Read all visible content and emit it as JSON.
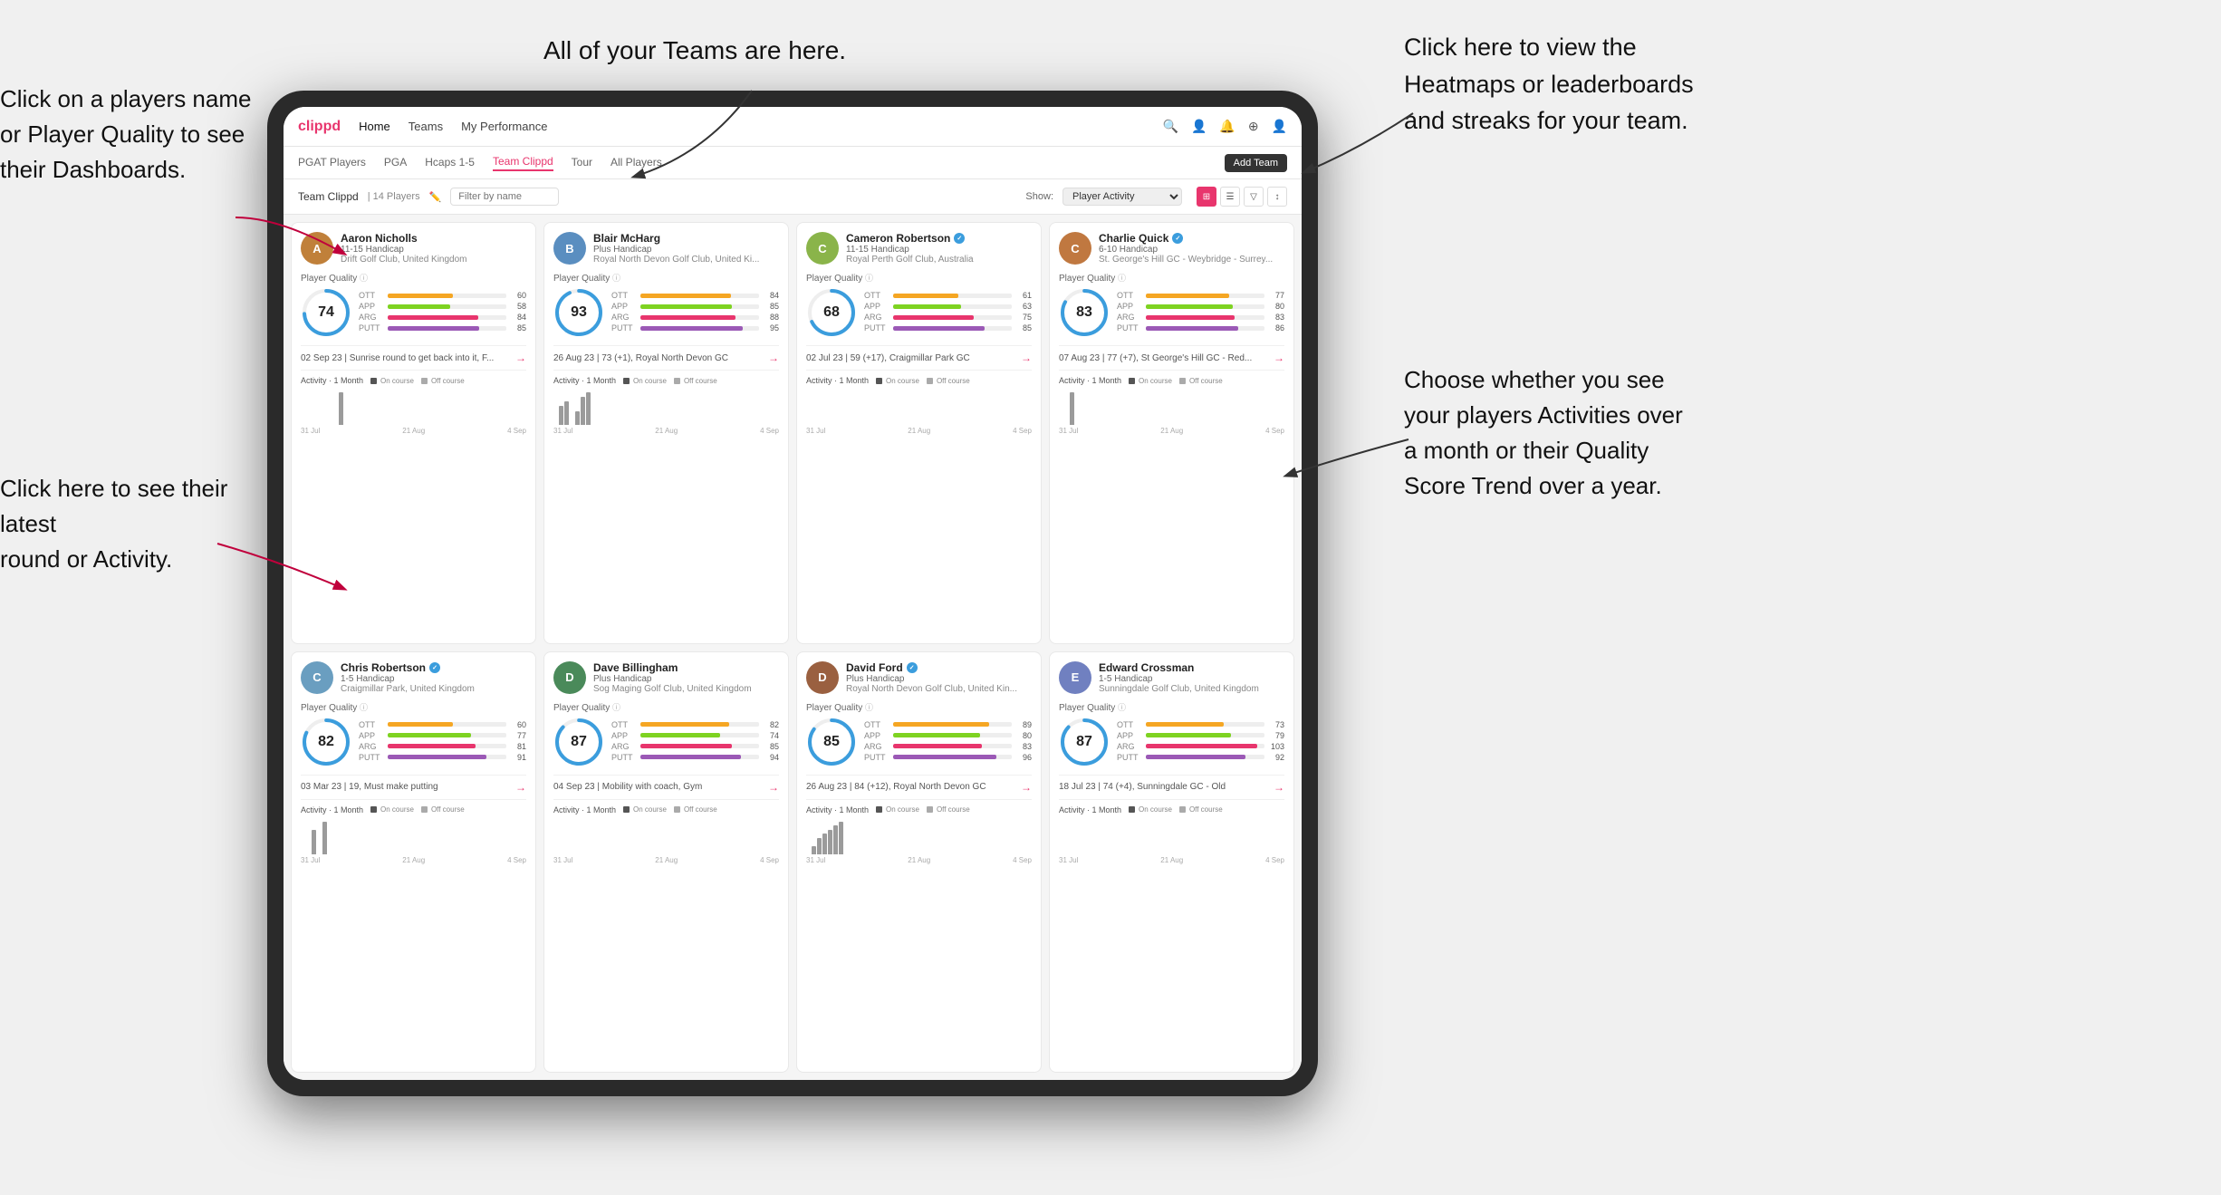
{
  "annotations": {
    "teams_tooltip": "All of your Teams are here.",
    "heatmaps_tooltip": "Click here to view the\nHeatmaps or leaderboards\nand streaks for your team.",
    "player_name_tooltip": "Click on a players name\nor Player Quality to see\ntheir Dashboards.",
    "latest_round_tooltip": "Click here to see their latest\nround or Activity.",
    "activity_tooltip": "Choose whether you see\nyour players Activities over\na month or their Quality\nScore Trend over a year."
  },
  "nav": {
    "logo": "clippd",
    "items": [
      "Home",
      "Teams",
      "My Performance"
    ],
    "icons": [
      "🔍",
      "👤",
      "🔔",
      "⊕",
      "👤"
    ]
  },
  "sub_nav": {
    "tabs": [
      "PGAT Players",
      "PGA",
      "Hcaps 1-5",
      "Team Clippd",
      "Tour",
      "All Players"
    ],
    "active": "Team Clippd",
    "add_team_label": "Add Team"
  },
  "team_bar": {
    "title": "Team Clippd",
    "separator": "|",
    "count": "14 Players",
    "filter_placeholder": "Filter by name",
    "show_label": "Show:",
    "show_options": [
      "Player Activity"
    ],
    "show_selected": "Player Activity"
  },
  "players": [
    {
      "name": "Aaron Nicholls",
      "handicap": "11-15 Handicap",
      "club": "Drift Golf Club, United Kingdom",
      "verified": false,
      "quality": 74,
      "quality_color": "#3b9ddd",
      "stats": [
        {
          "label": "OTT",
          "value": 60,
          "color": "#f5a623"
        },
        {
          "label": "APP",
          "value": 58,
          "color": "#7ed321"
        },
        {
          "label": "ARG",
          "value": 84,
          "color": "#e8356d"
        },
        {
          "label": "PUTT",
          "value": 85,
          "color": "#9b59b6"
        }
      ],
      "latest_round": "02 Sep 23 | Sunrise round to get back into it, F...",
      "activity_bars": [
        0,
        0,
        0,
        0,
        0,
        0,
        0,
        3,
        0,
        0
      ],
      "dates": [
        "31 Jul",
        "21 Aug",
        "4 Sep"
      ]
    },
    {
      "name": "Blair McHarg",
      "handicap": "Plus Handicap",
      "club": "Royal North Devon Golf Club, United Ki...",
      "verified": false,
      "quality": 93,
      "quality_color": "#3b9ddd",
      "stats": [
        {
          "label": "OTT",
          "value": 84,
          "color": "#f5a623"
        },
        {
          "label": "APP",
          "value": 85,
          "color": "#7ed321"
        },
        {
          "label": "ARG",
          "value": 88,
          "color": "#e8356d"
        },
        {
          "label": "PUTT",
          "value": 95,
          "color": "#9b59b6"
        }
      ],
      "latest_round": "26 Aug 23 | 73 (+1), Royal North Devon GC",
      "activity_bars": [
        0,
        4,
        5,
        0,
        3,
        6,
        7,
        0,
        0,
        0
      ],
      "dates": [
        "31 Jul",
        "21 Aug",
        "4 Sep"
      ]
    },
    {
      "name": "Cameron Robertson",
      "handicap": "11-15 Handicap",
      "club": "Royal Perth Golf Club, Australia",
      "verified": true,
      "quality": 68,
      "quality_color": "#3b9ddd",
      "stats": [
        {
          "label": "OTT",
          "value": 61,
          "color": "#f5a623"
        },
        {
          "label": "APP",
          "value": 63,
          "color": "#7ed321"
        },
        {
          "label": "ARG",
          "value": 75,
          "color": "#e8356d"
        },
        {
          "label": "PUTT",
          "value": 85,
          "color": "#9b59b6"
        }
      ],
      "latest_round": "02 Jul 23 | 59 (+17), Craigmillar Park GC",
      "activity_bars": [
        0,
        0,
        0,
        0,
        0,
        0,
        0,
        0,
        0,
        0
      ],
      "dates": [
        "31 Jul",
        "21 Aug",
        "4 Sep"
      ]
    },
    {
      "name": "Charlie Quick",
      "handicap": "6-10 Handicap",
      "club": "St. George's Hill GC - Weybridge - Surrey...",
      "verified": true,
      "quality": 83,
      "quality_color": "#3b9ddd",
      "stats": [
        {
          "label": "OTT",
          "value": 77,
          "color": "#f5a623"
        },
        {
          "label": "APP",
          "value": 80,
          "color": "#7ed321"
        },
        {
          "label": "ARG",
          "value": 83,
          "color": "#e8356d"
        },
        {
          "label": "PUTT",
          "value": 86,
          "color": "#9b59b6"
        }
      ],
      "latest_round": "07 Aug 23 | 77 (+7), St George's Hill GC - Red...",
      "activity_bars": [
        0,
        0,
        3,
        0,
        0,
        0,
        0,
        0,
        0,
        0
      ],
      "dates": [
        "31 Jul",
        "21 Aug",
        "4 Sep"
      ]
    },
    {
      "name": "Chris Robertson",
      "handicap": "1-5 Handicap",
      "club": "Craigmillar Park, United Kingdom",
      "verified": true,
      "quality": 82,
      "quality_color": "#3b9ddd",
      "stats": [
        {
          "label": "OTT",
          "value": 60,
          "color": "#f5a623"
        },
        {
          "label": "APP",
          "value": 77,
          "color": "#7ed321"
        },
        {
          "label": "ARG",
          "value": 81,
          "color": "#e8356d"
        },
        {
          "label": "PUTT",
          "value": 91,
          "color": "#9b59b6"
        }
      ],
      "latest_round": "03 Mar 23 | 19, Must make putting",
      "activity_bars": [
        0,
        0,
        3,
        0,
        4,
        0,
        0,
        0,
        0,
        0
      ],
      "dates": [
        "31 Jul",
        "21 Aug",
        "4 Sep"
      ]
    },
    {
      "name": "Dave Billingham",
      "handicap": "Plus Handicap",
      "club": "Sog Maging Golf Club, United Kingdom",
      "verified": false,
      "quality": 87,
      "quality_color": "#3b9ddd",
      "stats": [
        {
          "label": "OTT",
          "value": 82,
          "color": "#f5a623"
        },
        {
          "label": "APP",
          "value": 74,
          "color": "#7ed321"
        },
        {
          "label": "ARG",
          "value": 85,
          "color": "#e8356d"
        },
        {
          "label": "PUTT",
          "value": 94,
          "color": "#9b59b6"
        }
      ],
      "latest_round": "04 Sep 23 | Mobility with coach, Gym",
      "activity_bars": [
        0,
        0,
        0,
        0,
        0,
        0,
        0,
        0,
        0,
        0
      ],
      "dates": [
        "31 Jul",
        "21 Aug",
        "4 Sep"
      ]
    },
    {
      "name": "David Ford",
      "handicap": "Plus Handicap",
      "club": "Royal North Devon Golf Club, United Kin...",
      "verified": true,
      "quality": 85,
      "quality_color": "#3b9ddd",
      "stats": [
        {
          "label": "OTT",
          "value": 89,
          "color": "#f5a623"
        },
        {
          "label": "APP",
          "value": 80,
          "color": "#7ed321"
        },
        {
          "label": "ARG",
          "value": 83,
          "color": "#e8356d"
        },
        {
          "label": "PUTT",
          "value": 96,
          "color": "#9b59b6"
        }
      ],
      "latest_round": "26 Aug 23 | 84 (+12), Royal North Devon GC",
      "activity_bars": [
        0,
        2,
        4,
        5,
        6,
        7,
        8,
        0,
        0,
        0
      ],
      "dates": [
        "31 Jul",
        "21 Aug",
        "4 Sep"
      ]
    },
    {
      "name": "Edward Crossman",
      "handicap": "1-5 Handicap",
      "club": "Sunningdale Golf Club, United Kingdom",
      "verified": false,
      "quality": 87,
      "quality_color": "#3b9ddd",
      "stats": [
        {
          "label": "OTT",
          "value": 73,
          "color": "#f5a623"
        },
        {
          "label": "APP",
          "value": 79,
          "color": "#7ed321"
        },
        {
          "label": "ARG",
          "value": 103,
          "color": "#e8356d"
        },
        {
          "label": "PUTT",
          "value": 92,
          "color": "#9b59b6"
        }
      ],
      "latest_round": "18 Jul 23 | 74 (+4), Sunningdale GC - Old",
      "activity_bars": [
        0,
        0,
        0,
        0,
        0,
        0,
        0,
        0,
        0,
        0
      ],
      "dates": [
        "31 Jul",
        "21 Aug",
        "4 Sep"
      ]
    }
  ]
}
